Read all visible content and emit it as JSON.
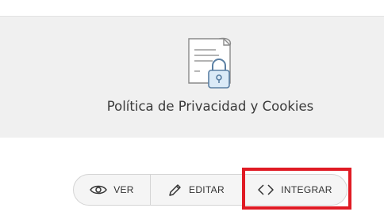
{
  "card": {
    "title": "Política de Privacidad y Cookies",
    "icon": "document-lock-icon"
  },
  "actions": {
    "view_label": "VER",
    "view_icon": "eye-icon",
    "edit_label": "EDITAR",
    "edit_icon": "pencil-icon",
    "embed_label": "INTEGRAR",
    "embed_icon": "code-icon"
  },
  "colors": {
    "card_background": "#f0f0f0",
    "highlight": "#e01b24",
    "lock_fill": "#dbeaf7",
    "lock_stroke": "#5a7fa3"
  }
}
